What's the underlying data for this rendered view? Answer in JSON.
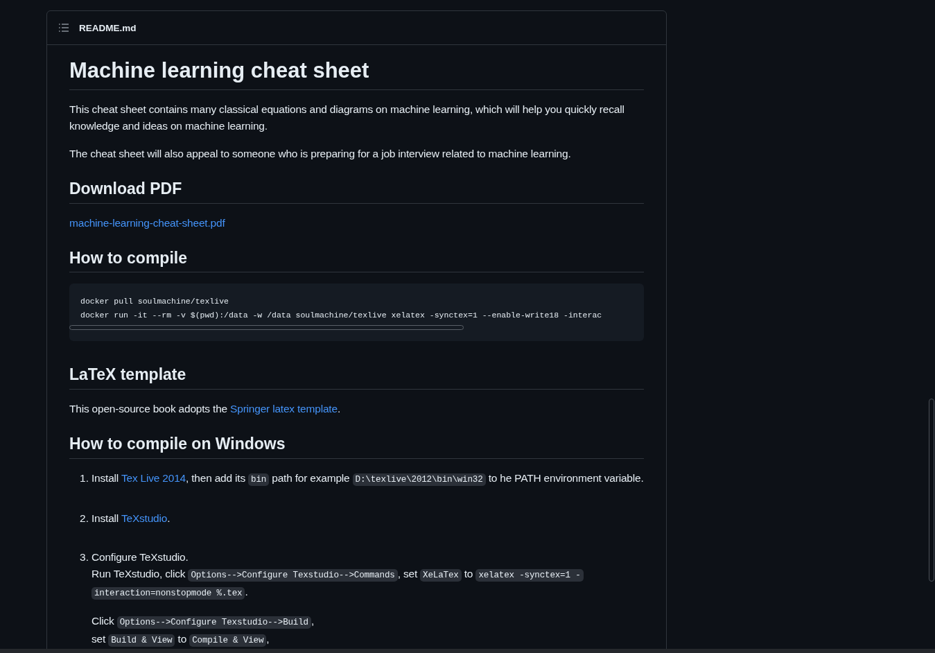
{
  "file_header": {
    "title": "README.md"
  },
  "blocks": [
    {
      "kind": "h1",
      "text": "Machine learning cheat sheet"
    },
    {
      "kind": "paragraph",
      "parts": [
        {
          "kind": "text",
          "text": "This cheat sheet contains many classical equations and diagrams on machine learning, which will help you quickly recall knowledge and ideas on machine learning."
        }
      ]
    },
    {
      "kind": "paragraph",
      "parts": [
        {
          "kind": "text",
          "text": "The cheat sheet will also appeal to someone who is preparing for a job interview related to machine learning."
        }
      ]
    },
    {
      "kind": "h2",
      "text": "Download PDF"
    },
    {
      "kind": "paragraph",
      "parts": [
        {
          "kind": "link",
          "text": "machine-learning-cheat-sheet.pdf"
        }
      ]
    },
    {
      "kind": "h2",
      "text": "How to compile"
    },
    {
      "kind": "code",
      "lines": [
        "docker pull soulmachine/texlive",
        "docker run -it --rm -v $(pwd):/data -w /data soulmachine/texlive xelatex -synctex=1 --enable-write18 -interac"
      ]
    },
    {
      "kind": "h2",
      "text": "LaTeX template"
    },
    {
      "kind": "paragraph",
      "parts": [
        {
          "kind": "text",
          "text": "This open-source book adopts the "
        },
        {
          "kind": "link",
          "text": "Springer latex template"
        },
        {
          "kind": "text",
          "text": "."
        }
      ]
    },
    {
      "kind": "h2",
      "text": "How to compile on Windows"
    },
    {
      "kind": "list",
      "items": [
        {
          "number": "1.",
          "paragraphs": [
            [
              {
                "kind": "text",
                "text": "Install "
              },
              {
                "kind": "link",
                "text": "Tex Live 2014"
              },
              {
                "kind": "text",
                "text": ", then add its "
              },
              {
                "kind": "code",
                "text": "bin"
              },
              {
                "kind": "text",
                "text": " path for example "
              },
              {
                "kind": "code",
                "text": "D:\\texlive\\2012\\bin\\win32"
              },
              {
                "kind": "text",
                "text": " to he PATH environment variable."
              }
            ]
          ]
        },
        {
          "number": "2.",
          "paragraphs": [
            [
              {
                "kind": "text",
                "text": "Install "
              },
              {
                "kind": "link",
                "text": "TeXstudio"
              },
              {
                "kind": "text",
                "text": "."
              }
            ]
          ]
        },
        {
          "number": "3.",
          "paragraphs": [
            [
              {
                "kind": "text",
                "text": "Configure TeXstudio."
              },
              {
                "kind": "break"
              },
              {
                "kind": "text",
                "text": "Run TeXstudio, click "
              },
              {
                "kind": "code",
                "text": "Options-->Configure Texstudio-->Commands"
              },
              {
                "kind": "text",
                "text": ", set "
              },
              {
                "kind": "code",
                "text": "XeLaTex"
              },
              {
                "kind": "text",
                "text": " to "
              },
              {
                "kind": "code",
                "text": "xelatex -synctex=1 -interaction=nonstopmode %.tex"
              },
              {
                "kind": "text",
                "text": "."
              }
            ],
            [
              {
                "kind": "text",
                "text": "Click "
              },
              {
                "kind": "code",
                "text": "Options-->Configure Texstudio-->Build"
              },
              {
                "kind": "text",
                "text": ","
              },
              {
                "kind": "break"
              },
              {
                "kind": "text",
                "text": "set "
              },
              {
                "kind": "code",
                "text": "Build & View"
              },
              {
                "kind": "text",
                "text": " to "
              },
              {
                "kind": "code",
                "text": "Compile & View"
              },
              {
                "kind": "text",
                "text": ","
              }
            ]
          ]
        }
      ]
    }
  ]
}
